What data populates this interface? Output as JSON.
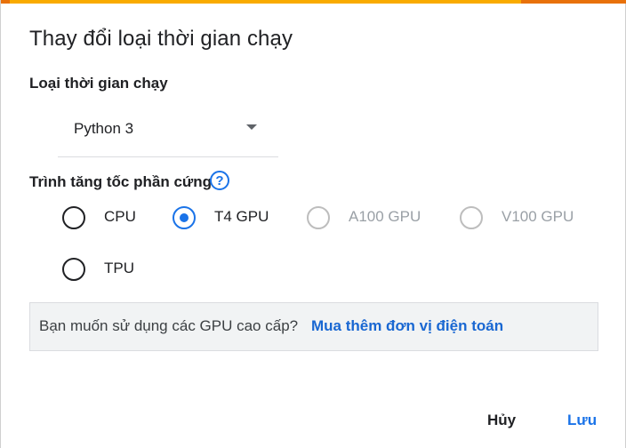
{
  "dialog": {
    "title": "Thay đổi loại thời gian chạy",
    "runtime_type": {
      "label": "Loại thời gian chạy",
      "selected": "Python 3"
    },
    "accelerator": {
      "label": "Trình tăng tốc phần cứng",
      "help_icon": "?",
      "options": [
        {
          "label": "CPU",
          "checked": false,
          "disabled": false
        },
        {
          "label": "T4 GPU",
          "checked": true,
          "disabled": false
        },
        {
          "label": "A100 GPU",
          "checked": false,
          "disabled": true
        },
        {
          "label": "V100 GPU",
          "checked": false,
          "disabled": true
        },
        {
          "label": "TPU",
          "checked": false,
          "disabled": false
        }
      ]
    },
    "upsell": {
      "text": "Bạn muốn sử dụng các GPU cao cấp?",
      "link": "Mua thêm đơn vị điện toán"
    },
    "buttons": {
      "cancel": "Hủy",
      "save": "Lưu"
    },
    "colors": {
      "accent": "#1a73e8",
      "top_bar": "#f9ab00",
      "top_bar_edge": "#e8710a"
    }
  }
}
